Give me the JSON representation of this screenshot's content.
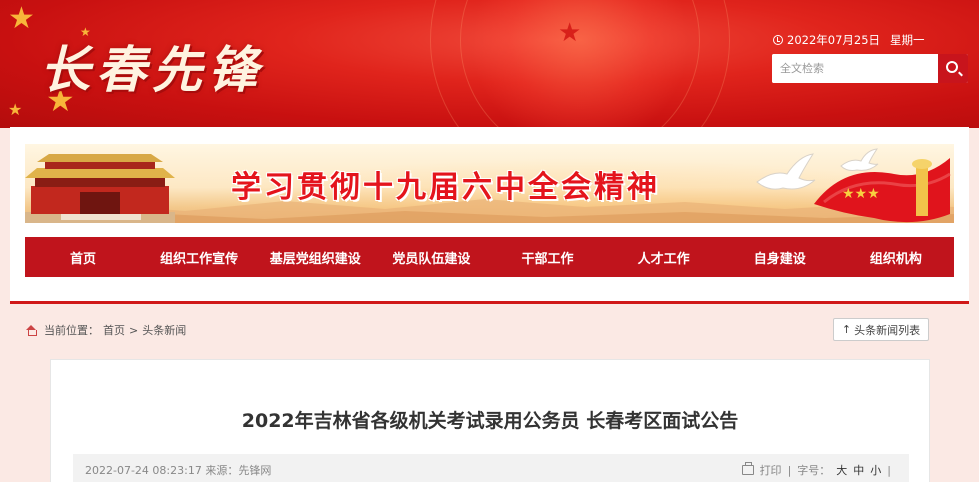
{
  "header": {
    "logo_text": "长春先锋",
    "date_text": "2022年07月25日",
    "weekday_text": "星期一",
    "search_placeholder": "全文检索"
  },
  "banner": {
    "title": "学习贯彻十九届六中全会精神"
  },
  "nav": {
    "items": [
      "首页",
      "组织工作宣传",
      "基层党组织建设",
      "党员队伍建设",
      "干部工作",
      "人才工作",
      "自身建设",
      "组织机构"
    ]
  },
  "breadcrumb": {
    "prefix": "当前位置：",
    "home": "首页",
    "separator": ">",
    "current": "头条新闻"
  },
  "list_button": {
    "arrow": "↑",
    "label": "头条新闻列表"
  },
  "article": {
    "title": "2022年吉林省各级机关考试录用公务员 长春考区面试公告",
    "datetime": "2022-07-24 08:23:17",
    "source_label": "来源：",
    "source": "先锋网",
    "print_label": "打印",
    "sep": "|",
    "font_label": "字号：",
    "font_large": "大",
    "font_medium": "中",
    "font_small": "小"
  },
  "colors": {
    "brand_red": "#c0141c",
    "header_red": "#e0241c",
    "star_gold": "#f8b53a"
  }
}
